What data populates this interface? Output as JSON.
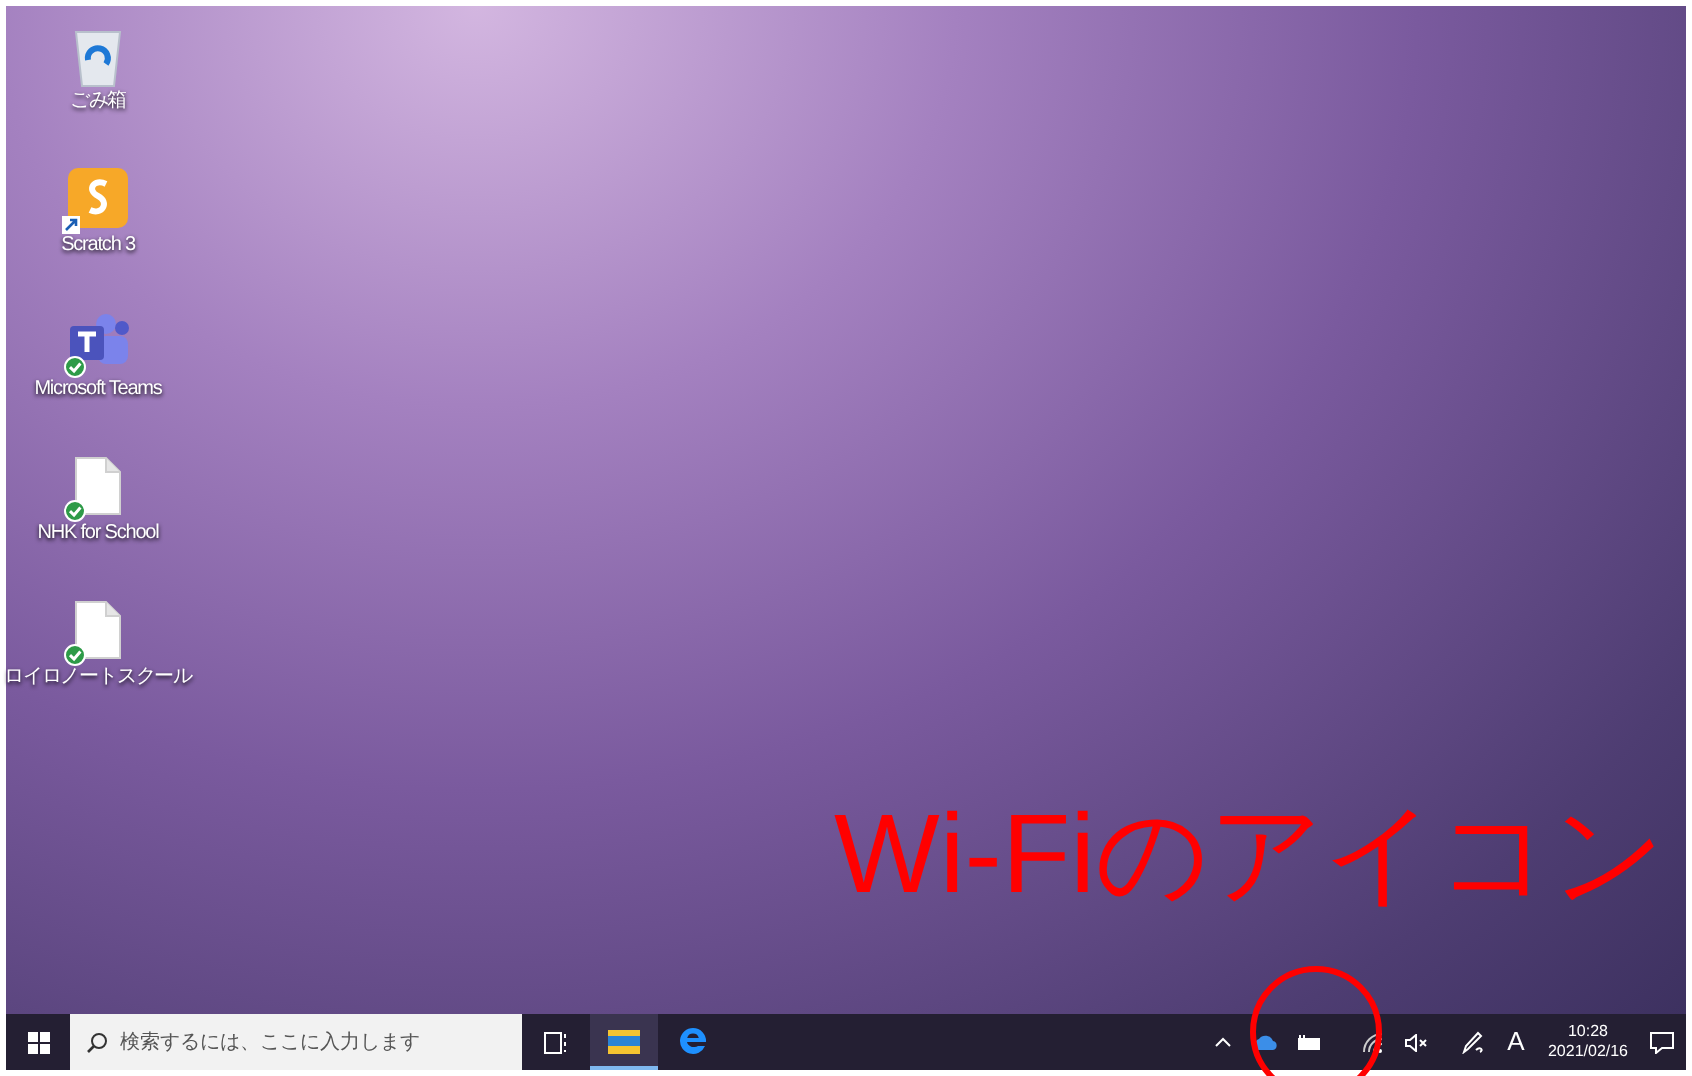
{
  "desktop_icons": [
    {
      "label": "ごみ箱",
      "kind": "recycle",
      "synced": false,
      "shortcut": false
    },
    {
      "label": "Scratch 3",
      "kind": "scratch",
      "synced": false,
      "shortcut": true
    },
    {
      "label": "Microsoft Teams",
      "kind": "teams",
      "synced": true,
      "shortcut": false
    },
    {
      "label": "NHK for School",
      "kind": "file",
      "synced": true,
      "shortcut": false
    },
    {
      "label": "ロイロノートスクール",
      "kind": "file",
      "synced": true,
      "shortcut": false
    }
  ],
  "annotation": {
    "text": "Wi-Fiのアイコン"
  },
  "taskbar": {
    "search": {
      "placeholder": "検索するには、ここに入力します"
    },
    "apps": [
      {
        "kind": "explorer",
        "selected": true
      },
      {
        "kind": "edge",
        "selected": false
      }
    ],
    "tray": {
      "ime": "A",
      "time": "10:28",
      "date": "2021/02/16"
    }
  }
}
